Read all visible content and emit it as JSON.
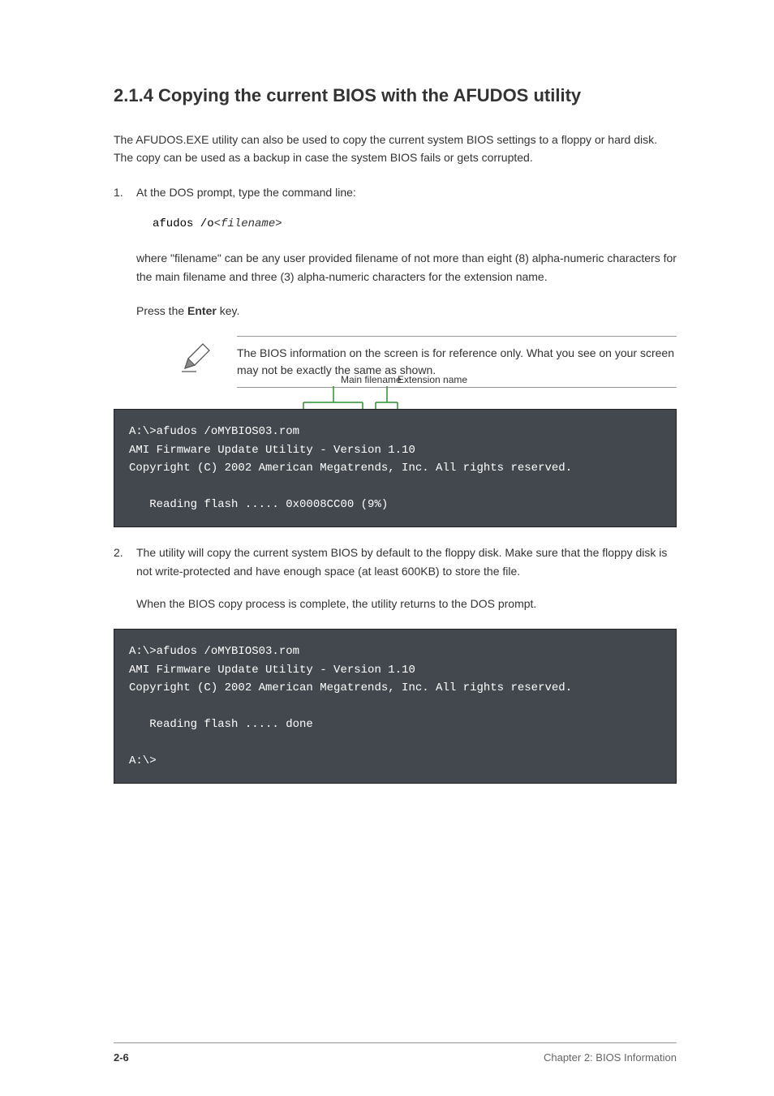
{
  "heading": "2.1.4 Copying the current BIOS with the AFUDOS utility",
  "intro_paragraph": "The AFUDOS.EXE utility can also be used to copy the current system BIOS settings to a floppy or hard disk. The copy can be used as a backup in case the system BIOS fails or gets corrupted.",
  "step1": {
    "number": "1.",
    "text_before": "At the DOS prompt, type the command line:",
    "command_line": "afudos /o",
    "filename_label": "<filename>",
    "text_after_before": "where \"filename\" can be any user provided filename of not more than eight (8) alpha-numeric characters for the main filename and three (3) alpha-numeric characters for the extension name.",
    "press_enter": "Press the Enter key."
  },
  "note": "The BIOS information on the screen is for reference only. What you see on your screen may not be exactly the same as shown.",
  "annotations": {
    "main_filename": "Main filename",
    "extension_name": "Extension name"
  },
  "terminal1": {
    "line1": "A:\\>afudos /oMYBIOS03.rom",
    "line2": "AMI Firmware Update Utility - Version 1.10",
    "line3": "Copyright (C) 2002 American Megatrends, Inc. All rights reserved.",
    "line4": "   Reading flash ..... 0x0008CC00 (9%)"
  },
  "step2": {
    "number": "2.",
    "text": "The utility will copy the current system BIOS by default to the floppy disk. Make sure that the floppy disk is not write-protected and have enough space (at least 600KB) to store the file.",
    "closing": "When the BIOS copy process is complete, the utility returns to the DOS prompt."
  },
  "terminal2": {
    "line1": "A:\\>afudos /oMYBIOS03.rom",
    "line2": "AMI Firmware Update Utility - Version 1.10",
    "line3": "Copyright (C) 2002 American Megatrends, Inc. All rights reserved.",
    "line4": "   Reading flash ..... done",
    "line5": "A:\\>"
  },
  "footer": {
    "page": "2-6",
    "chapter": "Chapter 2: BIOS Information"
  }
}
